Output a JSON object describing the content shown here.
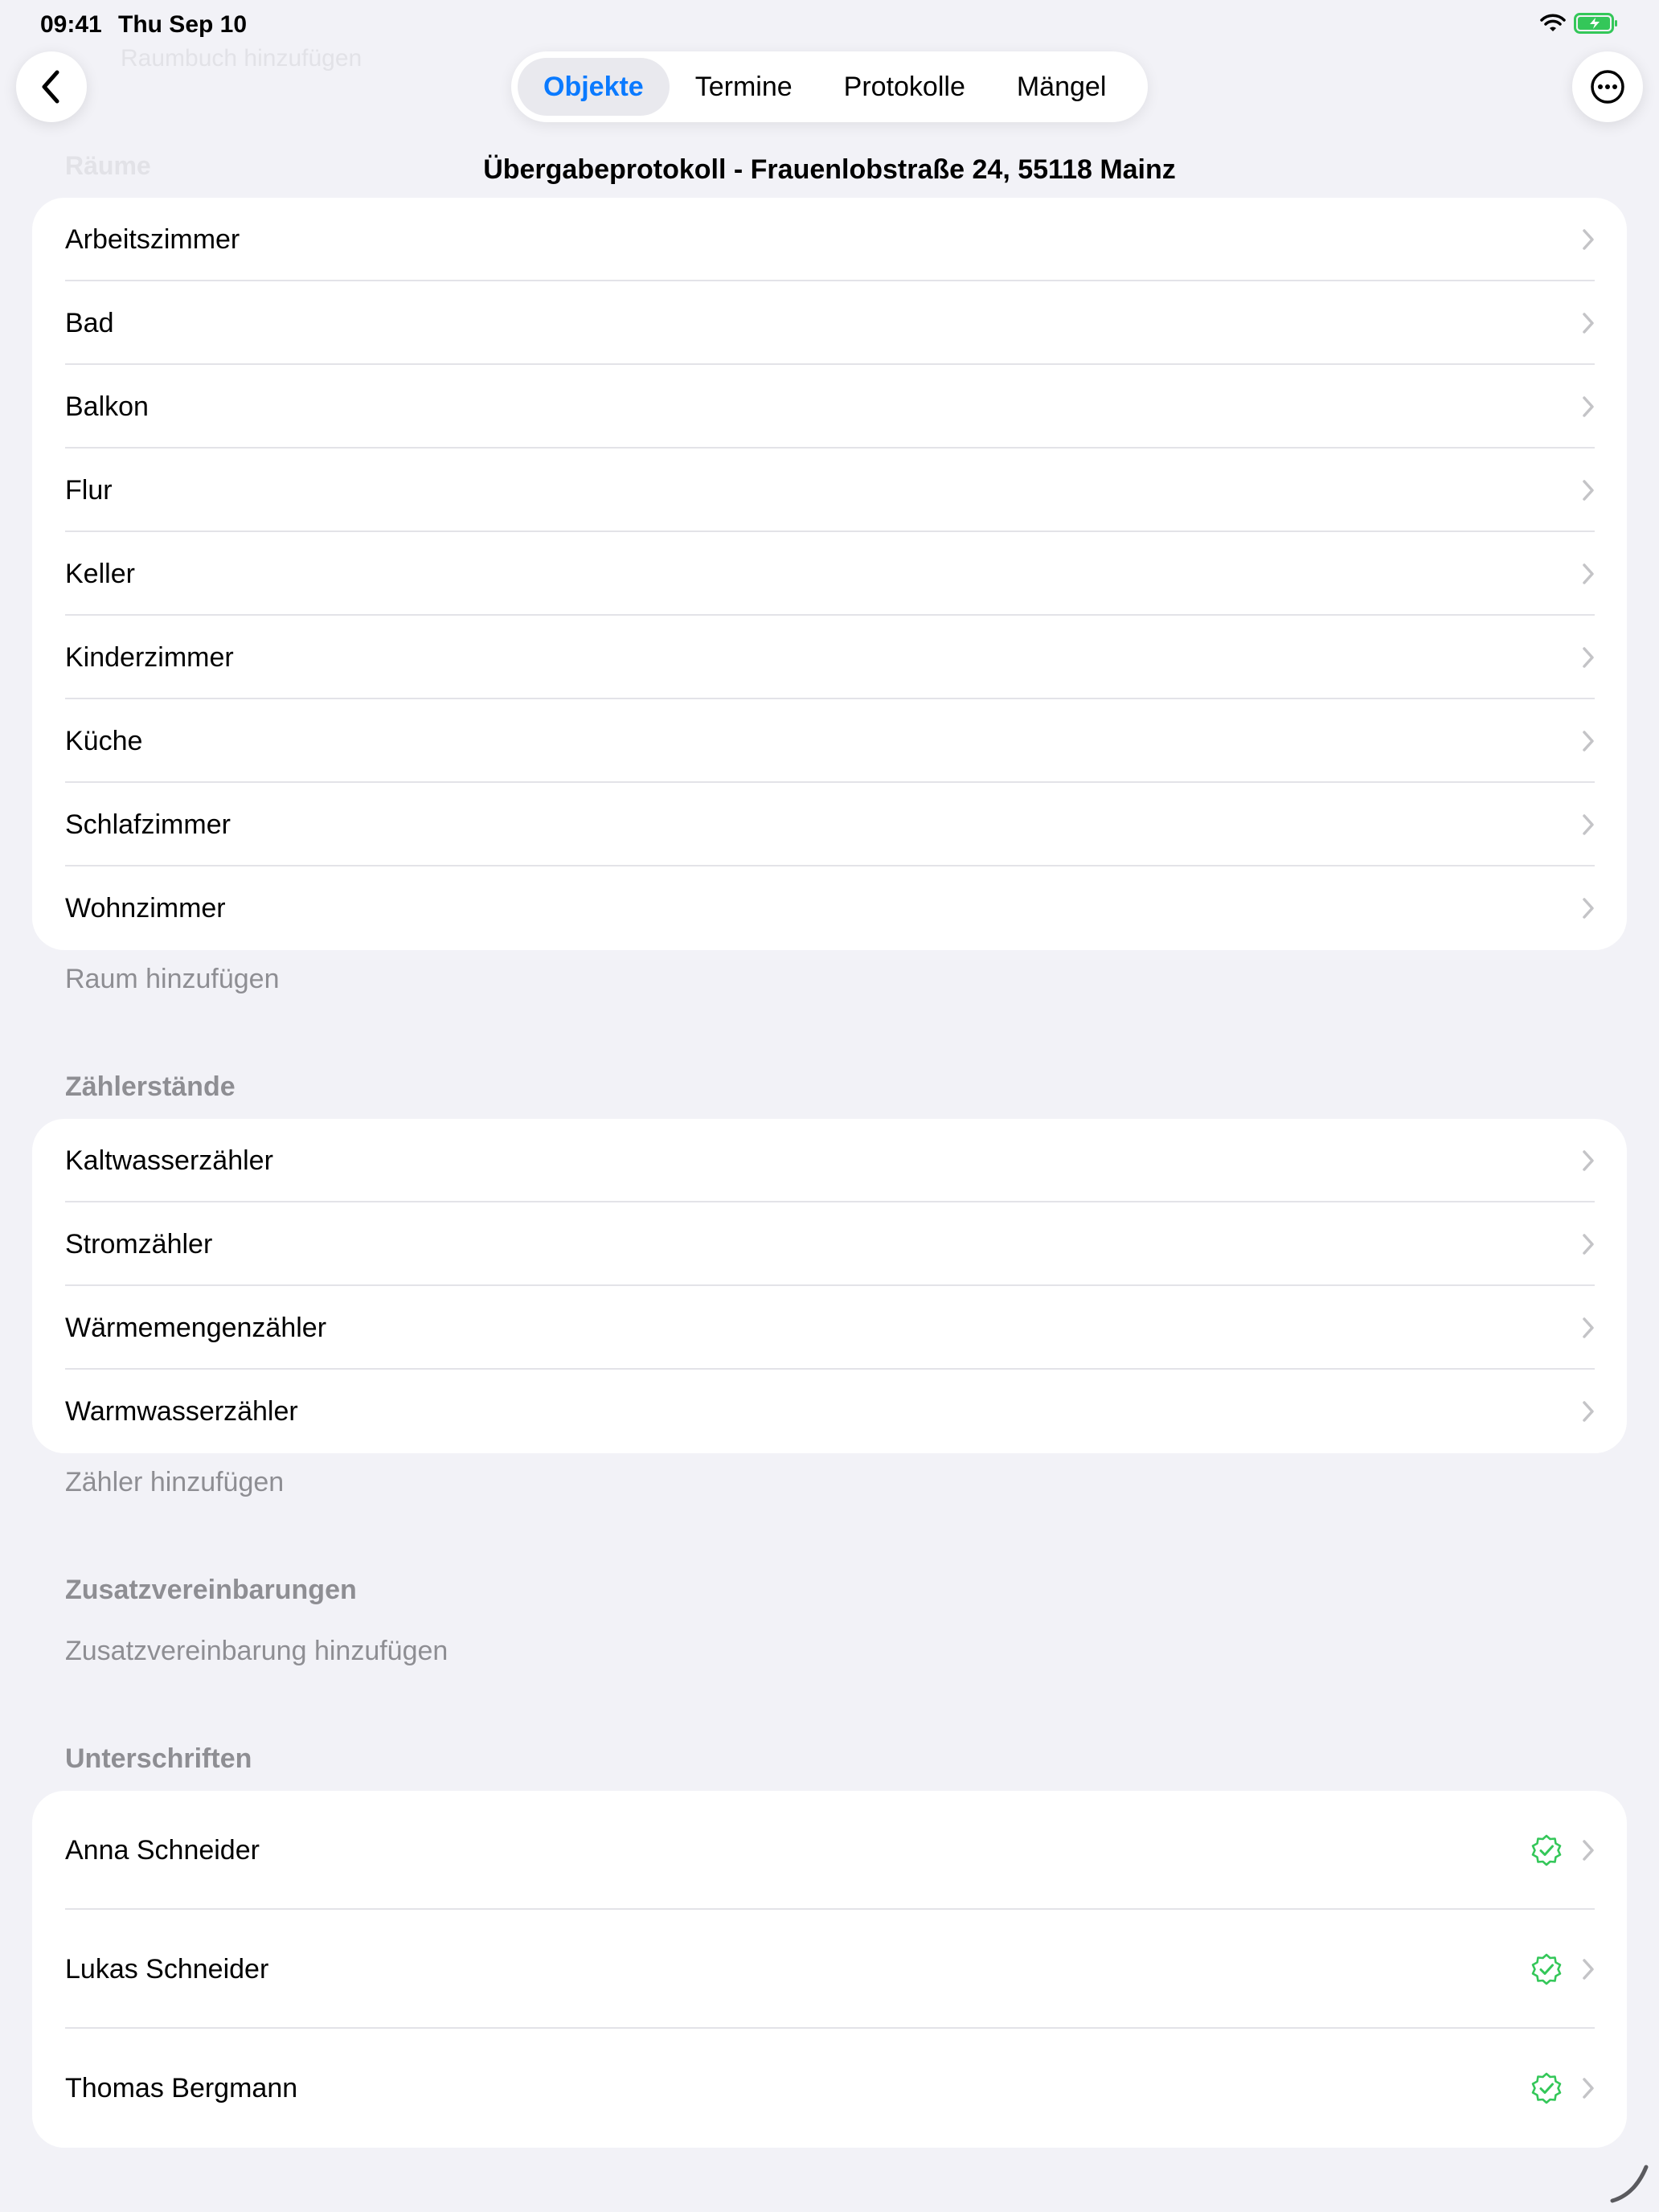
{
  "status_bar": {
    "time": "09:41",
    "date": "Thu Sep 10"
  },
  "ghost": {
    "top_text": "Raumbuch hinzufügen",
    "header_text": "Räume"
  },
  "tabs": [
    {
      "label": "Objekte",
      "active": true
    },
    {
      "label": "Termine",
      "active": false
    },
    {
      "label": "Protokolle",
      "active": false
    },
    {
      "label": "Mängel",
      "active": false
    }
  ],
  "page_title": "Übergabeprotokoll - Frauenlobstraße 24, 55118 Mainz",
  "rooms": {
    "items": [
      "Arbeitszimmer",
      "Bad",
      "Balkon",
      "Flur",
      "Keller",
      "Kinderzimmer",
      "Küche",
      "Schlafzimmer",
      "Wohnzimmer"
    ],
    "add_label": "Raum hinzufügen"
  },
  "meters": {
    "header": "Zählerstände",
    "items": [
      "Kaltwasserzähler",
      "Stromzähler",
      "Wärmemengenzähler",
      "Warmwasserzähler"
    ],
    "add_label": "Zähler hinzufügen"
  },
  "agreements": {
    "header": "Zusatzvereinbarungen",
    "add_label": "Zusatzvereinbarung hinzufügen"
  },
  "signatures": {
    "header": "Unterschriften",
    "items": [
      {
        "name": "Anna Schneider",
        "signed": true
      },
      {
        "name": "Lukas Schneider",
        "signed": true
      },
      {
        "name": "Thomas Bergmann",
        "signed": true
      }
    ]
  },
  "colors": {
    "accent": "#0a7aff",
    "signed_green": "#34c759",
    "background": "#f2f2f7",
    "secondary_text": "#8e8e93"
  },
  "icons": [
    "chevron-left-icon",
    "more-icon",
    "chevron-right-icon",
    "verified-check-icon",
    "wifi-icon",
    "battery-icon"
  ]
}
